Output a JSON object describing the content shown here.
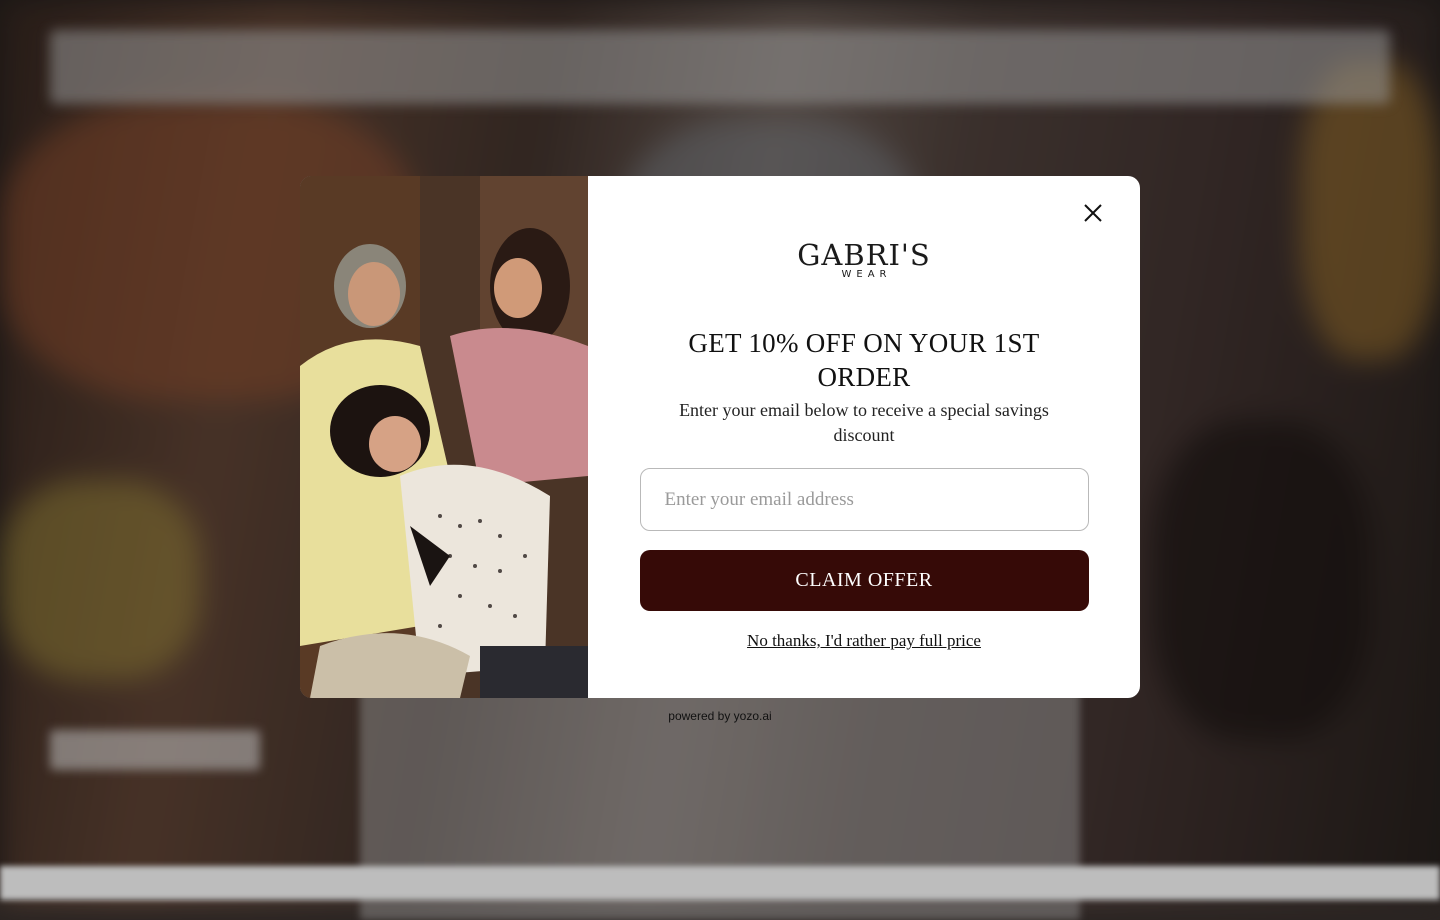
{
  "popup": {
    "brand": {
      "logo_main": "GABRI'S",
      "logo_sub": "WEAR"
    },
    "headline": "GET 10% OFF ON YOUR 1ST ORDER",
    "subtext": "Enter your email below to receive a special savings discount",
    "email_placeholder": "Enter your email address",
    "claim_label": "CLAIM OFFER",
    "decline_label": "No thanks, I'd rather pay full price",
    "close_icon": "close-icon",
    "image_description_icon": "promo-photo"
  },
  "footer": {
    "powered_by": "powered by yozo.ai"
  },
  "colors": {
    "claim_button": "#360a07",
    "popup_bg": "#ffffff",
    "input_border": "#b9b9b9"
  }
}
